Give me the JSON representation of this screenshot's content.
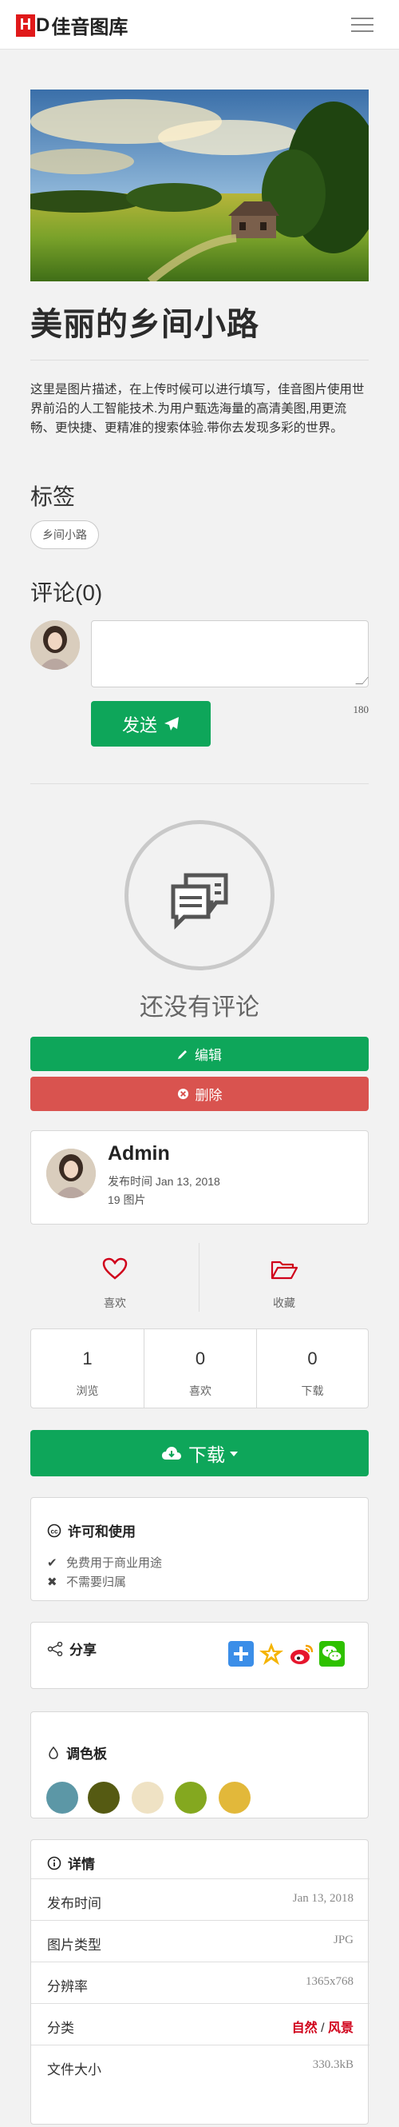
{
  "header": {
    "logo_hd": "H",
    "logo_d": "D",
    "logo_text": "佳音图库"
  },
  "photo": {
    "title": "美丽的乡间小路",
    "description": "这里是图片描述，在上传时候可以进行填写，佳音图片使用世界前沿的人工智能技术.为用户甄选海量的高清美图,用更流畅、更快捷、更精准的搜索体验.带你去发现多彩的世界。"
  },
  "tags": {
    "heading": "标签",
    "items": [
      "乡间小路"
    ]
  },
  "comments": {
    "heading": "评论(0)",
    "textarea_value": "",
    "char_count": "180",
    "send_label": "发送",
    "empty_text": "还没有评论"
  },
  "actions": {
    "edit_label": "编辑",
    "delete_label": "删除"
  },
  "author": {
    "name": "Admin",
    "published": "发布时间 Jan 13, 2018",
    "count": "19 图片"
  },
  "reactions": {
    "like_label": "喜欢",
    "favorite_label": "收藏"
  },
  "stats": [
    {
      "value": "1",
      "label": "浏览"
    },
    {
      "value": "0",
      "label": "喜欢"
    },
    {
      "value": "0",
      "label": "下载"
    }
  ],
  "download": {
    "label": "下载"
  },
  "license": {
    "heading": "许可和使用",
    "items": [
      {
        "icon": "check-icon",
        "text": "免费用于商业用途"
      },
      {
        "icon": "x-icon",
        "text": "不需要归属"
      }
    ]
  },
  "share": {
    "heading": "分享",
    "icons": [
      "plus-share-icon",
      "qzone-icon",
      "weibo-icon",
      "wechat-icon"
    ]
  },
  "palette": {
    "heading": "调色板",
    "colors": [
      "#5c97a6",
      "#555a12",
      "#efe2c4",
      "#84a81f",
      "#e2b83a"
    ]
  },
  "details": {
    "heading": "详情",
    "rows": [
      {
        "key": "发布时间",
        "value": "Jan 13, 2018"
      },
      {
        "key": "图片类型",
        "value": "JPG"
      },
      {
        "key": "分辨率",
        "value": "1365x768"
      },
      {
        "key": "分类",
        "value": ""
      },
      {
        "key": "文件大小",
        "value": "330.3kB"
      }
    ],
    "category_a": "自然",
    "category_sep": " / ",
    "category_b": "风景"
  },
  "colors": {
    "accent_green": "#0ea65a",
    "danger_red": "#d9534f",
    "logo_red": "#e0191a",
    "category_red": "#d0021b"
  }
}
